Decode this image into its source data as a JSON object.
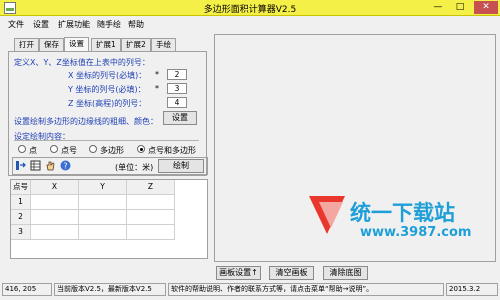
{
  "window": {
    "title": "多边形面积计算器V2.5",
    "minimize_glyph": "—",
    "maximize_glyph": "□",
    "close_glyph": "✕"
  },
  "menu": [
    "文件",
    "设置",
    "扩展功能",
    "随手绘",
    "帮助"
  ],
  "tabs": [
    "打开",
    "保存",
    "设置",
    "扩展1",
    "扩展2",
    "手绘"
  ],
  "active_tab": "设置",
  "settings": {
    "columns_heading": "定义X、Y、Z坐标值在上表中的列号：",
    "x_label": "X 坐标的列号(必填)：",
    "x_value": "2",
    "y_label": "Y 坐标的列号(必填)：",
    "y_value": "3",
    "z_label": "Z 坐标(高程)的列号：",
    "z_value": "4",
    "required_mark": "*",
    "line_style_label": "设置绘制多边形的边缘线的粗细、颜色：",
    "settings_button": "设置",
    "content_label": "设定绘制内容：",
    "radio_options": [
      "点",
      "点号",
      "多边形",
      "点号和多边形"
    ],
    "radio_selected": 3
  },
  "toolbar": {
    "unit_label": "(单位：米)",
    "draw_button": "绘制"
  },
  "grid": {
    "headers": [
      "点号",
      "X",
      "Y",
      "Z"
    ],
    "rows": [
      [
        "1",
        "",
        "",
        ""
      ],
      [
        "2",
        "",
        "",
        ""
      ],
      [
        "3",
        "",
        "",
        ""
      ]
    ]
  },
  "canvas_buttons": [
    "画板设置↑",
    "清空画板",
    "清除底图"
  ],
  "watermark": {
    "text": "统一下载站",
    "url": "www.3987.com"
  },
  "status_bar": {
    "coords": "416, 205",
    "version": "当前版本V2.5，最新版本V2.5",
    "help": "软件的帮助说明、作者的联系方式等，请点击菜单“帮助→说明”。",
    "date": "2015.3.2"
  }
}
